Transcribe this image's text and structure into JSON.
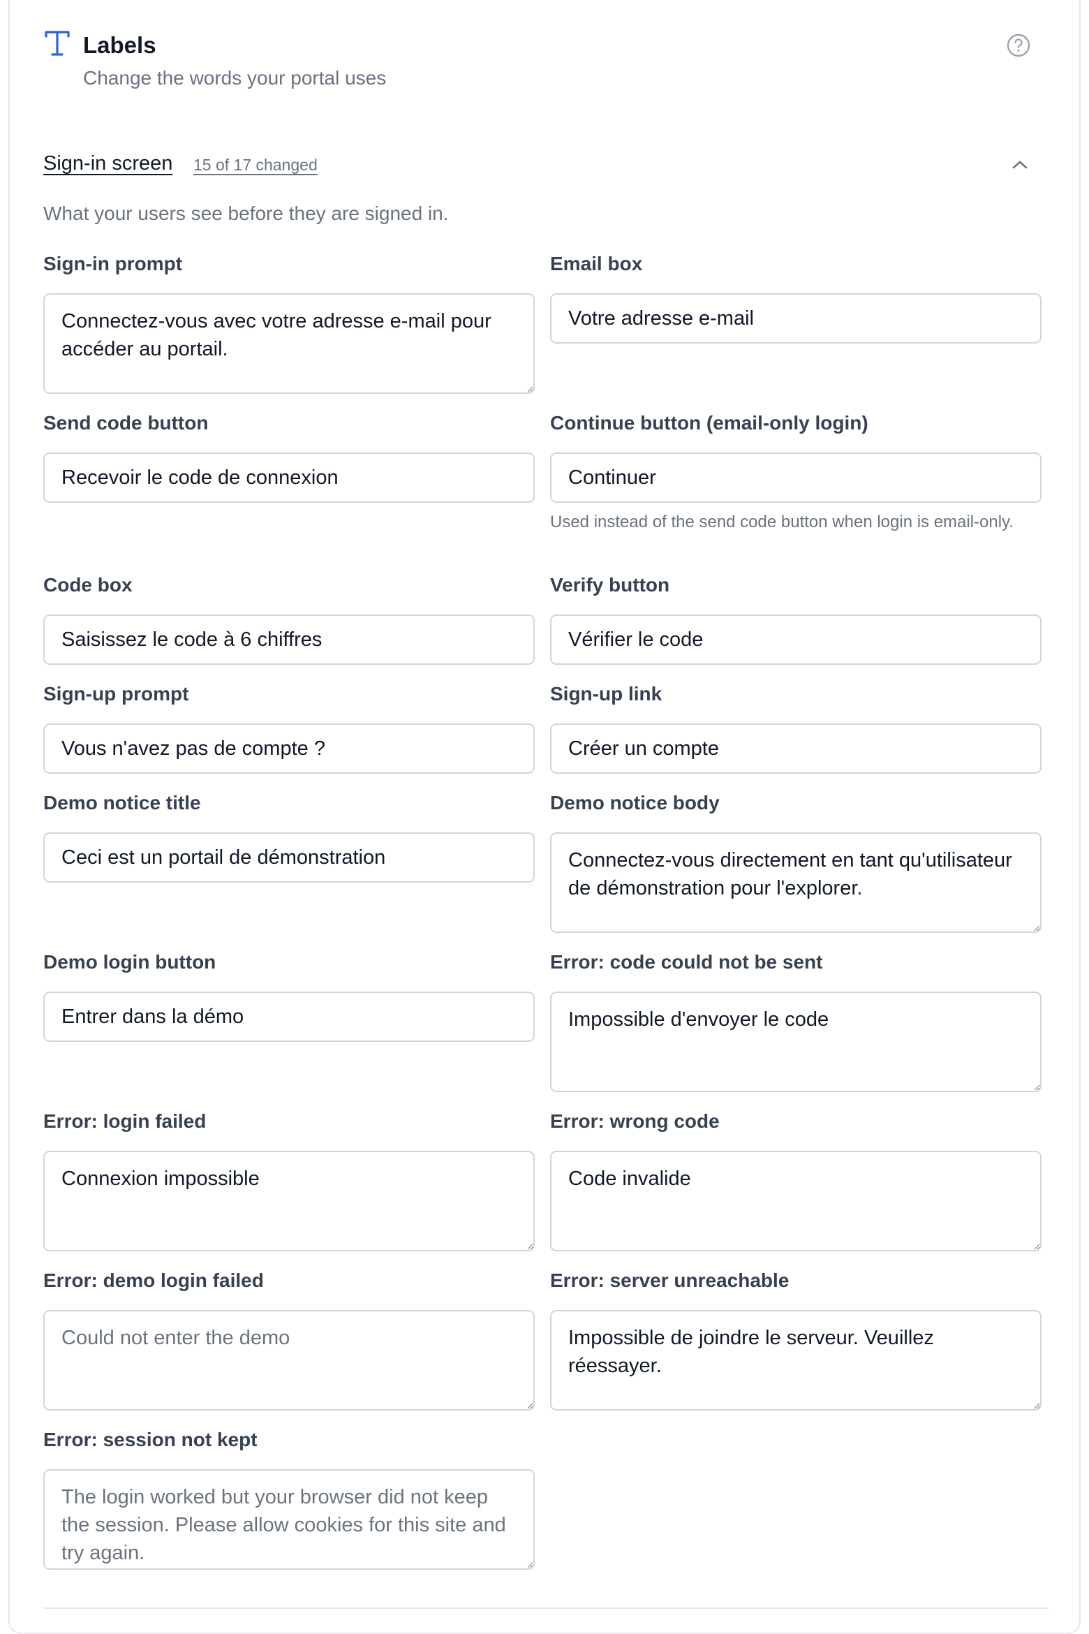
{
  "header": {
    "title": "Labels",
    "subtitle": "Change the words your portal uses",
    "icon": "text-type-icon",
    "help_icon": "help-circle-icon",
    "accent": "#2563eb"
  },
  "section": {
    "title": "Sign-in screen",
    "count": "15 of 17 changed",
    "description": "What your users see before they are signed in.",
    "expanded": true
  },
  "fields": [
    {
      "label": "Sign-in prompt",
      "value": "Connectez-vous avec votre adresse e-mail pour accéder au portail.",
      "placeholder": ""
    },
    {
      "label": "Email box",
      "value": "Votre adresse e-mail",
      "placeholder": ""
    },
    {
      "label": "Send code button",
      "value": "Recevoir le code de connexion",
      "placeholder": ""
    },
    {
      "label": "Continue button (email-only login)",
      "value": "Continuer",
      "placeholder": "",
      "hint": "Used instead of the send code button when login is email-only."
    },
    {
      "label": "Code box",
      "value": "Saisissez le code à 6 chiffres",
      "placeholder": ""
    },
    {
      "label": "Verify button",
      "value": "Vérifier le code",
      "placeholder": ""
    },
    {
      "label": "Sign-up prompt",
      "value": "Vous n'avez pas de compte ?",
      "placeholder": ""
    },
    {
      "label": "Sign-up link",
      "value": "Créer un compte",
      "placeholder": ""
    },
    {
      "label": "Demo notice title",
      "value": "Ceci est un portail de démonstration",
      "placeholder": ""
    },
    {
      "label": "Demo notice body",
      "value": "Connectez-vous directement en tant qu'utilisateur de démonstration pour l'explorer.",
      "placeholder": ""
    },
    {
      "label": "Demo login button",
      "value": "Entrer dans la démo",
      "placeholder": ""
    },
    {
      "label": "Error: code could not be sent",
      "value": "Impossible d'envoyer le code",
      "placeholder": ""
    },
    {
      "label": "Error: login failed",
      "value": "Connexion impossible",
      "placeholder": ""
    },
    {
      "label": "Error: wrong code",
      "value": "Code invalide",
      "placeholder": ""
    },
    {
      "label": "Error: demo login failed",
      "value": "",
      "placeholder": "Could not enter the demo"
    },
    {
      "label": "Error: server unreachable",
      "value": "Impossible de joindre le serveur. Veuillez réessayer.",
      "placeholder": ""
    },
    {
      "label": "Error: session not kept",
      "value": "",
      "placeholder": "The login worked but your browser did not keep the session. Please allow cookies for this site and try again."
    }
  ]
}
